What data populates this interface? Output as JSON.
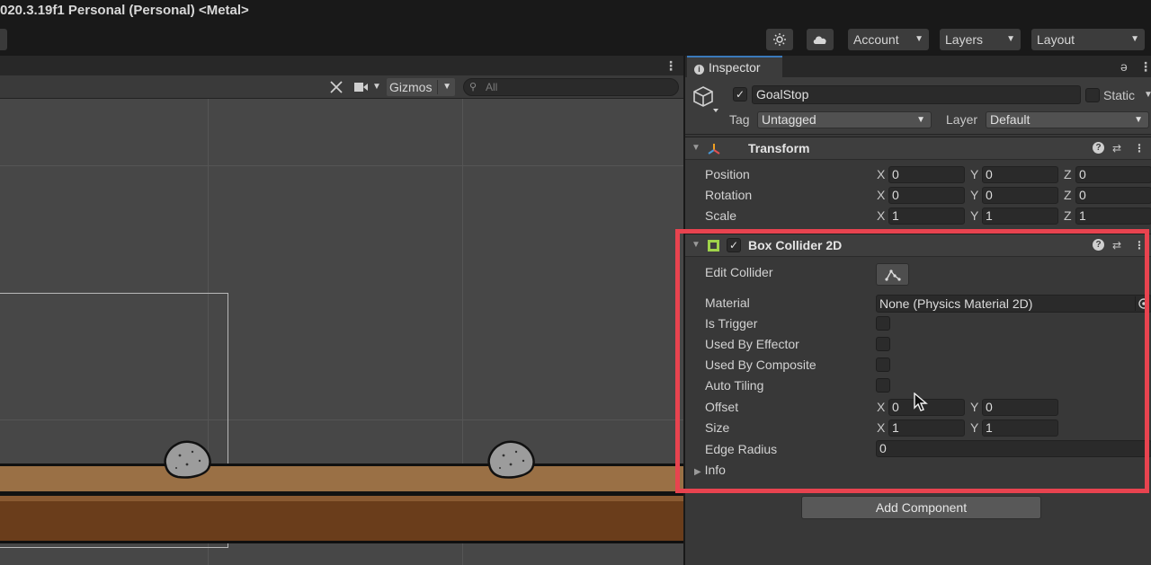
{
  "window": {
    "title": "020.3.19f1 Personal (Personal) <Metal>"
  },
  "toolbar": {
    "account_label": "Account",
    "layers_label": "Layers",
    "layout_label": "Layout",
    "sun_icon": "light-icon",
    "cloud_icon": "cloud-icon"
  },
  "scene": {
    "gizmos_label": "Gizmos",
    "search_placeholder": "All"
  },
  "inspector": {
    "tab_label": "Inspector",
    "gameobject": {
      "active": true,
      "name": "GoalStop",
      "static_label": "Static",
      "tag_label": "Tag",
      "tag_value": "Untagged",
      "layer_label": "Layer",
      "layer_value": "Default"
    },
    "transform": {
      "title": "Transform",
      "position_label": "Position",
      "rotation_label": "Rotation",
      "scale_label": "Scale",
      "x_label": "X",
      "y_label": "Y",
      "z_label": "Z",
      "position": {
        "x": "0",
        "y": "0",
        "z": "0"
      },
      "rotation": {
        "x": "0",
        "y": "0",
        "z": "0"
      },
      "scale": {
        "x": "1",
        "y": "1",
        "z": "1"
      }
    },
    "box_collider": {
      "title": "Box Collider 2D",
      "enabled": true,
      "edit_collider_label": "Edit Collider",
      "material_label": "Material",
      "material_value": "None (Physics Material 2D)",
      "is_trigger_label": "Is Trigger",
      "used_by_effector_label": "Used By Effector",
      "used_by_composite_label": "Used By Composite",
      "auto_tiling_label": "Auto Tiling",
      "offset_label": "Offset",
      "size_label": "Size",
      "edge_radius_label": "Edge Radius",
      "info_label": "Info",
      "offset": {
        "x": "0",
        "y": "0"
      },
      "size": {
        "x": "1",
        "y": "1"
      },
      "edge_radius": "0"
    },
    "add_component_label": "Add Component"
  },
  "colors": {
    "highlight": "#e8434f",
    "tab_accent": "#3a79bb",
    "ground_top": "#9a7045",
    "ground_bottom": "#6a3d1b"
  }
}
